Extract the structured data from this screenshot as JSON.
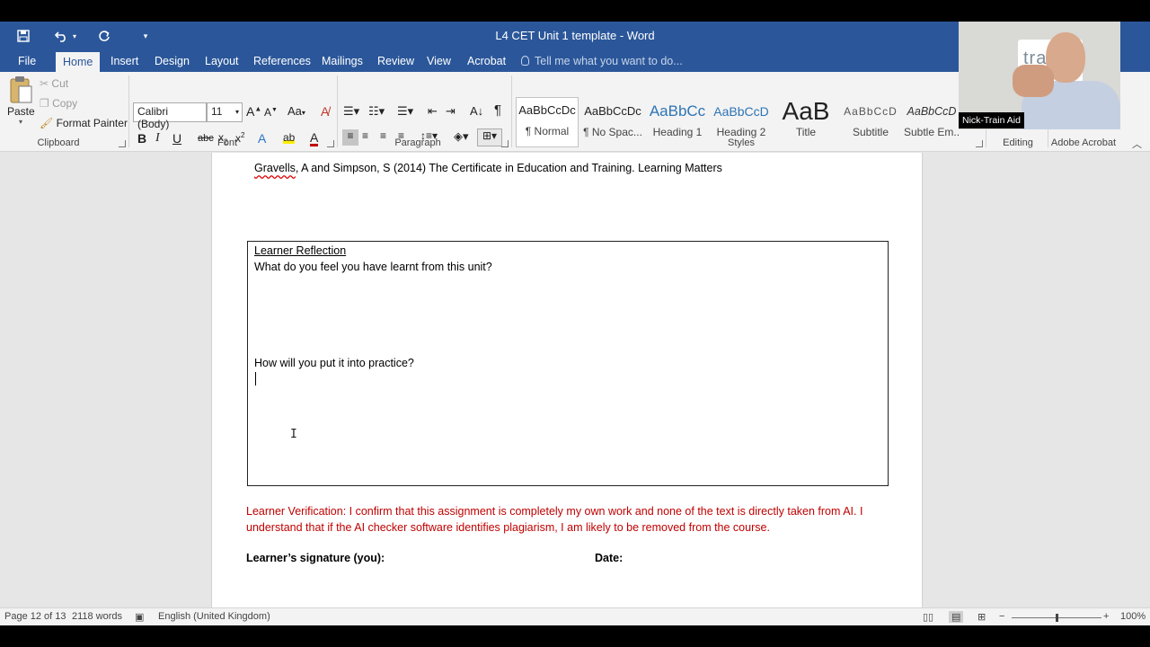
{
  "window": {
    "title": "L4 CET Unit 1 template - Word"
  },
  "qat": {
    "save_icon": "save-icon",
    "undo_icon": "undo-icon",
    "redo_icon": "redo-icon",
    "customize_icon": "customize-icon"
  },
  "tabs": {
    "file": "File",
    "home": "Home",
    "insert": "Insert",
    "design": "Design",
    "layout": "Layout",
    "references": "References",
    "mailings": "Mailings",
    "review": "Review",
    "view": "View",
    "acrobat": "Acrobat"
  },
  "tellme": {
    "placeholder": "Tell me what you want to do..."
  },
  "ribbon": {
    "clipboard": {
      "label": "Clipboard",
      "paste": "Paste",
      "cut": "Cut",
      "copy": "Copy",
      "format_painter": "Format Painter"
    },
    "font": {
      "label": "Font",
      "family": "Calibri (Body)",
      "size": "11"
    },
    "paragraph": {
      "label": "Paragraph"
    },
    "styles": {
      "label": "Styles",
      "items": [
        {
          "preview": "AaBbCcDc",
          "name": "¶ Normal"
        },
        {
          "preview": "AaBbCcDc",
          "name": "¶ No Spac..."
        },
        {
          "preview": "AaBbCc",
          "name": "Heading 1"
        },
        {
          "preview": "AaBbCcD",
          "name": "Heading 2"
        },
        {
          "preview": "AaB",
          "name": "Title"
        },
        {
          "preview": "AaBbCcD",
          "name": "Subtitle"
        },
        {
          "preview": "AaBbCcD",
          "name": "Subtle Em..."
        }
      ]
    },
    "editing": {
      "label": "Editing"
    },
    "adobe": {
      "label": "Adobe Acrobat"
    }
  },
  "webcam": {
    "name": "Nick-Train Aid",
    "wall_text": "tra"
  },
  "document": {
    "reference_author": "Gravells",
    "reference_rest": ", A and Simpson, S (2014) The Certificate in Education and Training. Learning Matters",
    "reflection_heading": "Learner Reflection",
    "question1": "What do you feel you have learnt from this unit?",
    "question2": "How will you put it into practice?",
    "verification": "Learner Verification: I confirm that this assignment is completely my own work and none of the text is directly taken from AI. I understand that if the AI checker software identifies plagiarism, I am likely to be removed from the course.",
    "signature_label": "Learner’s signature (you):",
    "date_label": "Date:"
  },
  "status": {
    "page": "Page 12 of 13",
    "words": "2118 words",
    "language": "English (United Kingdom)",
    "zoom": "100%",
    "zoom_fraction": 0.5
  },
  "colors": {
    "brand": "#2b579a",
    "verification": "#c00000"
  }
}
